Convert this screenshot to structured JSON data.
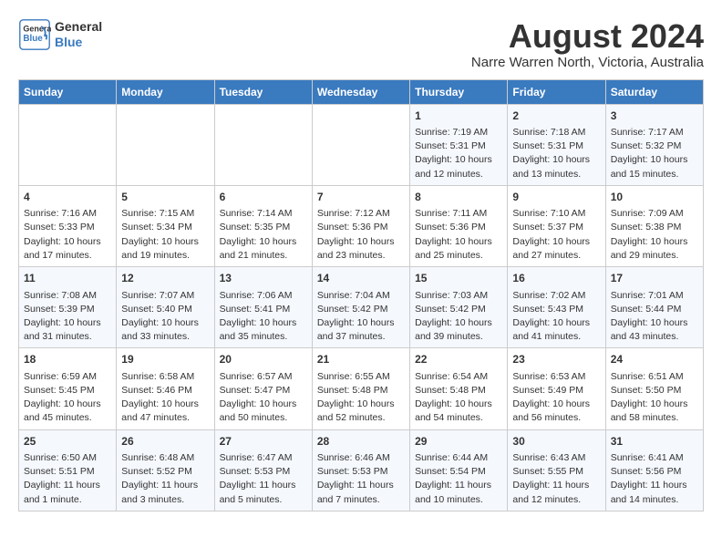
{
  "header": {
    "logo_line1": "General",
    "logo_line2": "Blue",
    "month": "August 2024",
    "location": "Narre Warren North, Victoria, Australia"
  },
  "weekdays": [
    "Sunday",
    "Monday",
    "Tuesday",
    "Wednesday",
    "Thursday",
    "Friday",
    "Saturday"
  ],
  "weeks": [
    [
      {
        "day": "",
        "info": ""
      },
      {
        "day": "",
        "info": ""
      },
      {
        "day": "",
        "info": ""
      },
      {
        "day": "",
        "info": ""
      },
      {
        "day": "1",
        "info": "Sunrise: 7:19 AM\nSunset: 5:31 PM\nDaylight: 10 hours\nand 12 minutes."
      },
      {
        "day": "2",
        "info": "Sunrise: 7:18 AM\nSunset: 5:31 PM\nDaylight: 10 hours\nand 13 minutes."
      },
      {
        "day": "3",
        "info": "Sunrise: 7:17 AM\nSunset: 5:32 PM\nDaylight: 10 hours\nand 15 minutes."
      }
    ],
    [
      {
        "day": "4",
        "info": "Sunrise: 7:16 AM\nSunset: 5:33 PM\nDaylight: 10 hours\nand 17 minutes."
      },
      {
        "day": "5",
        "info": "Sunrise: 7:15 AM\nSunset: 5:34 PM\nDaylight: 10 hours\nand 19 minutes."
      },
      {
        "day": "6",
        "info": "Sunrise: 7:14 AM\nSunset: 5:35 PM\nDaylight: 10 hours\nand 21 minutes."
      },
      {
        "day": "7",
        "info": "Sunrise: 7:12 AM\nSunset: 5:36 PM\nDaylight: 10 hours\nand 23 minutes."
      },
      {
        "day": "8",
        "info": "Sunrise: 7:11 AM\nSunset: 5:36 PM\nDaylight: 10 hours\nand 25 minutes."
      },
      {
        "day": "9",
        "info": "Sunrise: 7:10 AM\nSunset: 5:37 PM\nDaylight: 10 hours\nand 27 minutes."
      },
      {
        "day": "10",
        "info": "Sunrise: 7:09 AM\nSunset: 5:38 PM\nDaylight: 10 hours\nand 29 minutes."
      }
    ],
    [
      {
        "day": "11",
        "info": "Sunrise: 7:08 AM\nSunset: 5:39 PM\nDaylight: 10 hours\nand 31 minutes."
      },
      {
        "day": "12",
        "info": "Sunrise: 7:07 AM\nSunset: 5:40 PM\nDaylight: 10 hours\nand 33 minutes."
      },
      {
        "day": "13",
        "info": "Sunrise: 7:06 AM\nSunset: 5:41 PM\nDaylight: 10 hours\nand 35 minutes."
      },
      {
        "day": "14",
        "info": "Sunrise: 7:04 AM\nSunset: 5:42 PM\nDaylight: 10 hours\nand 37 minutes."
      },
      {
        "day": "15",
        "info": "Sunrise: 7:03 AM\nSunset: 5:42 PM\nDaylight: 10 hours\nand 39 minutes."
      },
      {
        "day": "16",
        "info": "Sunrise: 7:02 AM\nSunset: 5:43 PM\nDaylight: 10 hours\nand 41 minutes."
      },
      {
        "day": "17",
        "info": "Sunrise: 7:01 AM\nSunset: 5:44 PM\nDaylight: 10 hours\nand 43 minutes."
      }
    ],
    [
      {
        "day": "18",
        "info": "Sunrise: 6:59 AM\nSunset: 5:45 PM\nDaylight: 10 hours\nand 45 minutes."
      },
      {
        "day": "19",
        "info": "Sunrise: 6:58 AM\nSunset: 5:46 PM\nDaylight: 10 hours\nand 47 minutes."
      },
      {
        "day": "20",
        "info": "Sunrise: 6:57 AM\nSunset: 5:47 PM\nDaylight: 10 hours\nand 50 minutes."
      },
      {
        "day": "21",
        "info": "Sunrise: 6:55 AM\nSunset: 5:48 PM\nDaylight: 10 hours\nand 52 minutes."
      },
      {
        "day": "22",
        "info": "Sunrise: 6:54 AM\nSunset: 5:48 PM\nDaylight: 10 hours\nand 54 minutes."
      },
      {
        "day": "23",
        "info": "Sunrise: 6:53 AM\nSunset: 5:49 PM\nDaylight: 10 hours\nand 56 minutes."
      },
      {
        "day": "24",
        "info": "Sunrise: 6:51 AM\nSunset: 5:50 PM\nDaylight: 10 hours\nand 58 minutes."
      }
    ],
    [
      {
        "day": "25",
        "info": "Sunrise: 6:50 AM\nSunset: 5:51 PM\nDaylight: 11 hours\nand 1 minute."
      },
      {
        "day": "26",
        "info": "Sunrise: 6:48 AM\nSunset: 5:52 PM\nDaylight: 11 hours\nand 3 minutes."
      },
      {
        "day": "27",
        "info": "Sunrise: 6:47 AM\nSunset: 5:53 PM\nDaylight: 11 hours\nand 5 minutes."
      },
      {
        "day": "28",
        "info": "Sunrise: 6:46 AM\nSunset: 5:53 PM\nDaylight: 11 hours\nand 7 minutes."
      },
      {
        "day": "29",
        "info": "Sunrise: 6:44 AM\nSunset: 5:54 PM\nDaylight: 11 hours\nand 10 minutes."
      },
      {
        "day": "30",
        "info": "Sunrise: 6:43 AM\nSunset: 5:55 PM\nDaylight: 11 hours\nand 12 minutes."
      },
      {
        "day": "31",
        "info": "Sunrise: 6:41 AM\nSunset: 5:56 PM\nDaylight: 11 hours\nand 14 minutes."
      }
    ]
  ]
}
